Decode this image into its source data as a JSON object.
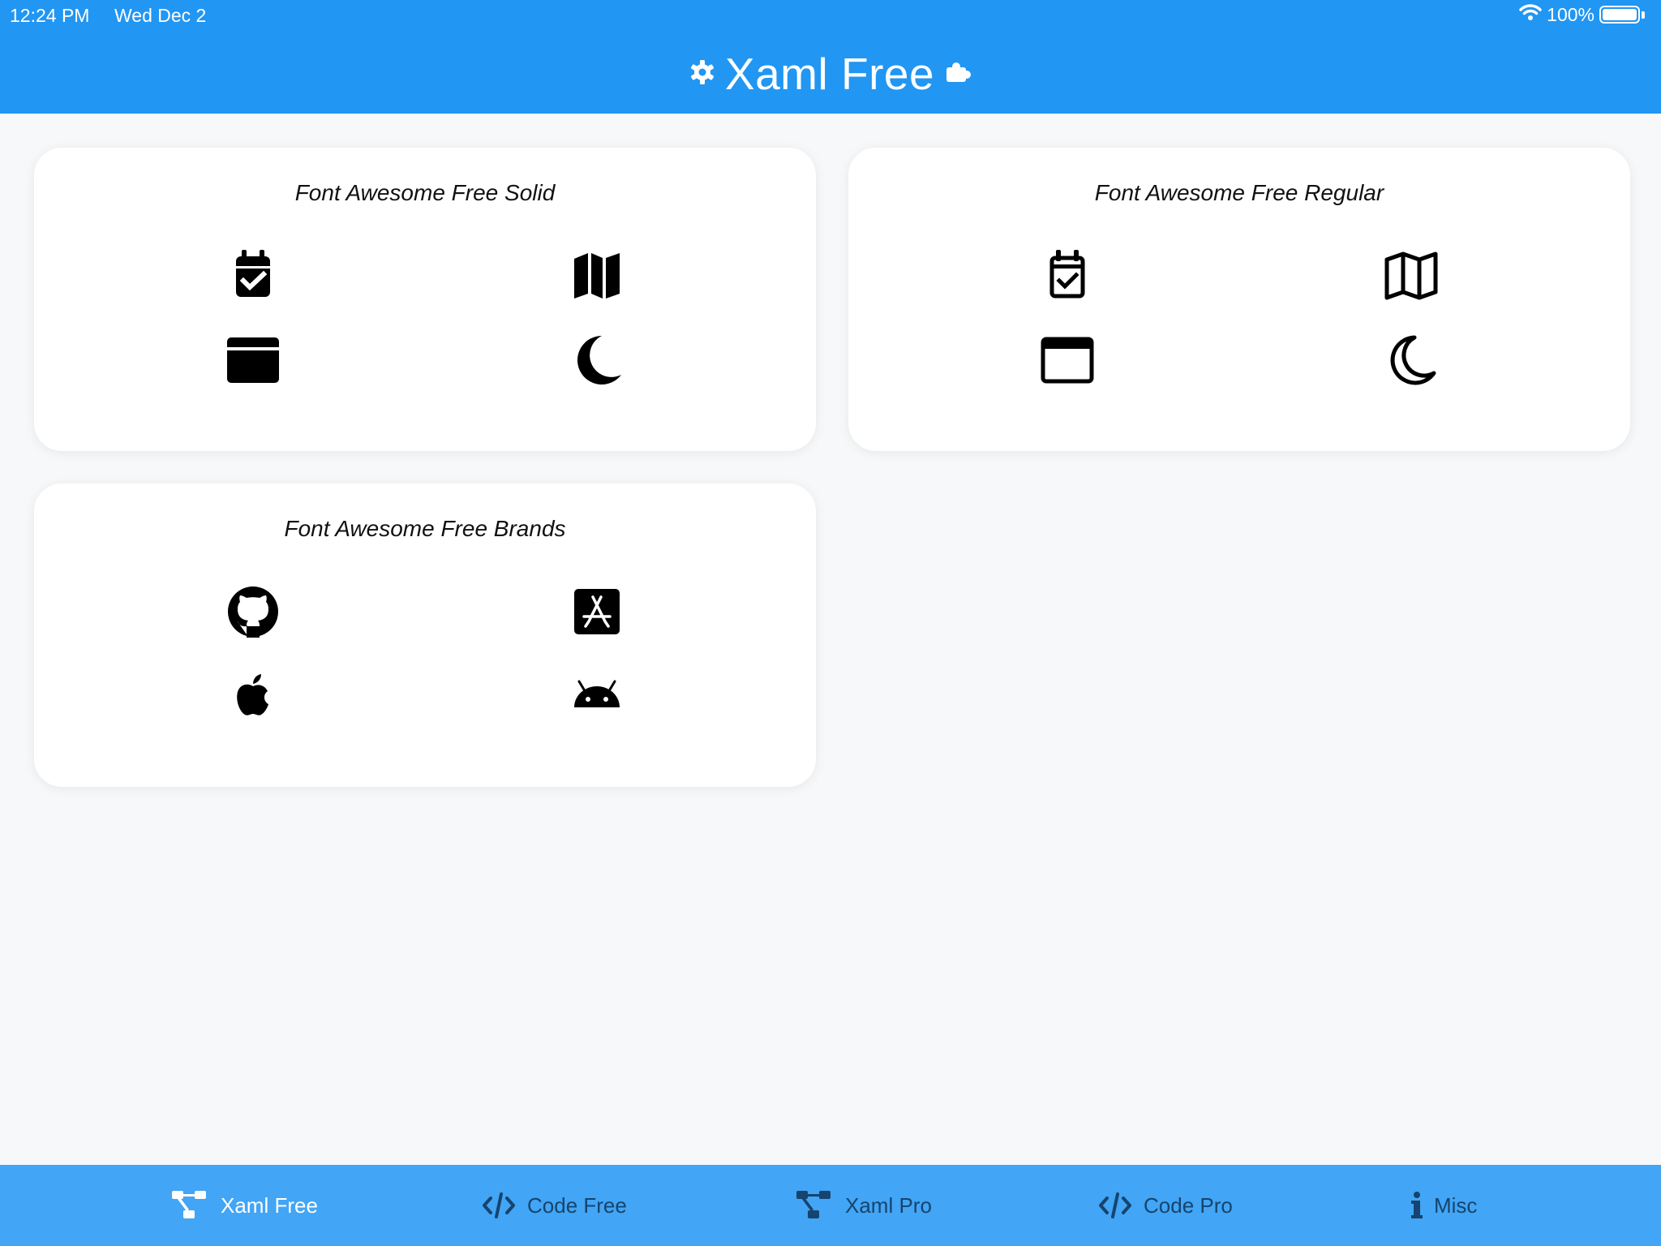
{
  "status": {
    "time": "12:24 PM",
    "date": "Wed Dec 2",
    "battery": "100%"
  },
  "header": {
    "title": "Xaml Free"
  },
  "cards": {
    "solid": {
      "title": "Font Awesome Free Solid"
    },
    "regular": {
      "title": "Font Awesome Free Regular"
    },
    "brands": {
      "title": "Font Awesome Free Brands"
    }
  },
  "tabs": [
    {
      "label": "Xaml Free",
      "icon": "project-diagram-icon",
      "active": true
    },
    {
      "label": "Code Free",
      "icon": "code-icon",
      "active": false
    },
    {
      "label": "Xaml Pro",
      "icon": "project-diagram-icon",
      "active": false
    },
    {
      "label": "Code Pro",
      "icon": "code-icon",
      "active": false
    },
    {
      "label": "Misc",
      "icon": "info-icon",
      "active": false
    }
  ],
  "colors": {
    "header": "#2196f3",
    "tabbar": "#42a5f5",
    "tab_inactive": "#16446e",
    "background": "#f7f8fa"
  }
}
